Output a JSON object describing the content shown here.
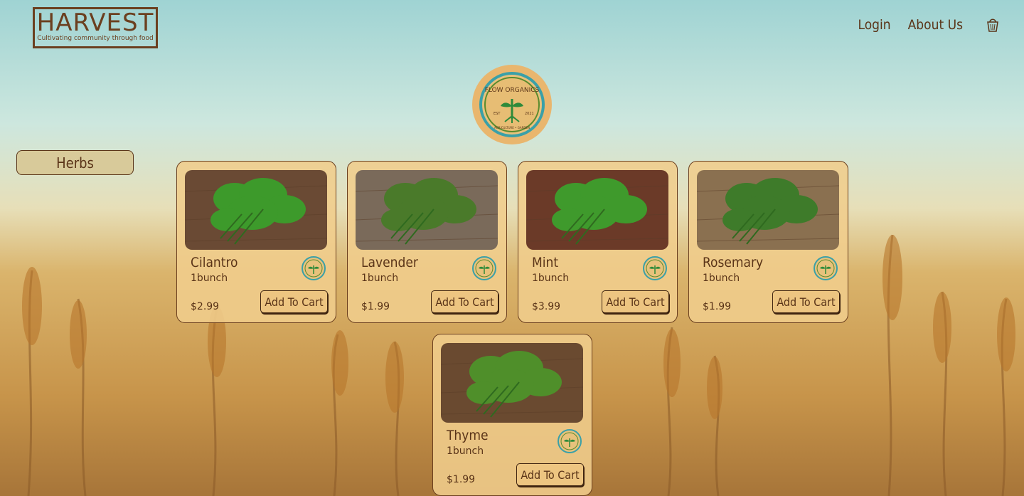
{
  "brand": {
    "name": "HARVEST",
    "tagline": "Cultivating community through food"
  },
  "nav": {
    "login": "Login",
    "about": "About Us",
    "cart_icon": "shopping-basket-icon"
  },
  "vendor": {
    "logo_text": "FLOW ORGANICS",
    "logo_sub": "AGRICULTURE • GARDEN",
    "est_left": "EST",
    "est_right": "2021"
  },
  "category": {
    "label": "Herbs"
  },
  "products": [
    {
      "name": "Cilantro",
      "unit": "1bunch",
      "price": "$2.99",
      "button": "Add To Cart",
      "leaf_color": "#3d9a2b"
    },
    {
      "name": "Lavender",
      "unit": "1bunch",
      "price": "$1.99",
      "button": "Add To Cart",
      "leaf_color": "#4a7a2a"
    },
    {
      "name": "Mint",
      "unit": "1bunch",
      "price": "$3.99",
      "button": "Add To Cart",
      "leaf_color": "#3f9a2c"
    },
    {
      "name": "Rosemary",
      "unit": "1bunch",
      "price": "$1.99",
      "button": "Add To Cart",
      "leaf_color": "#3e7b2a"
    },
    {
      "name": "Thyme",
      "unit": "1bunch",
      "price": "$1.99",
      "button": "Add To Cart",
      "leaf_color": "#4f8f2a"
    }
  ]
}
